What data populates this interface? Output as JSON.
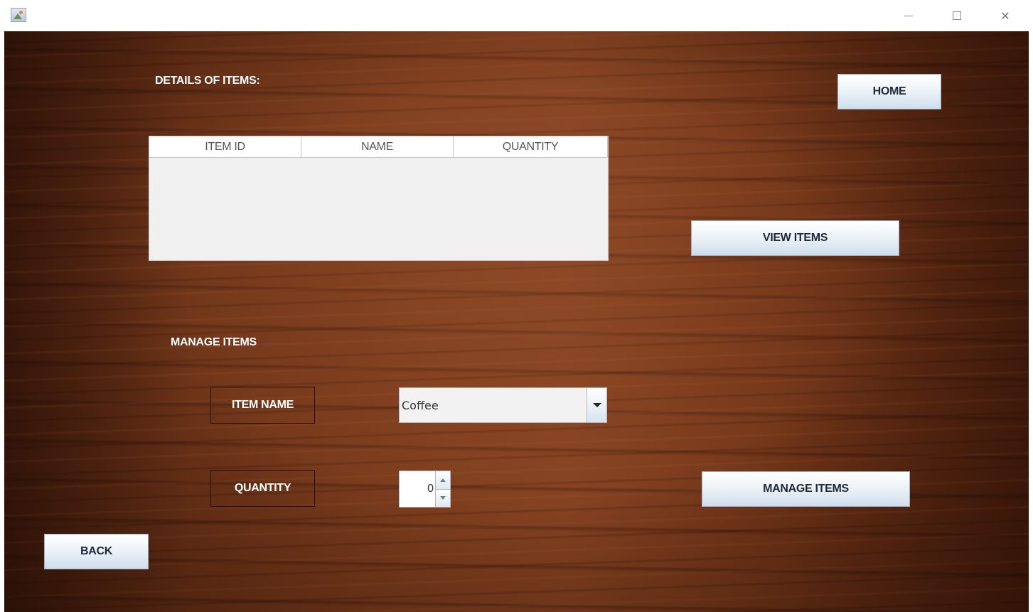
{
  "window": {
    "min_icon": "minimize-icon",
    "max_icon": "maximize-icon",
    "close_icon": "close-icon",
    "close_glyph": "✕"
  },
  "details": {
    "heading": "DETAILS OF ITEMS:",
    "table": {
      "columns": [
        "ITEM ID",
        "NAME",
        "QUANTITY"
      ],
      "rows": []
    }
  },
  "buttons": {
    "home": "HOME",
    "view_items": "VIEW ITEMS",
    "manage_items": "MANAGE ITEMS",
    "back": "BACK"
  },
  "manage": {
    "heading": "MANAGE ITEMS",
    "item_name_label": "ITEM NAME",
    "item_name_value": "Coffee",
    "quantity_label": "QUANTITY",
    "quantity_value": "0"
  },
  "colors": {
    "wood_dark": "#4a1f0d",
    "wood_mid": "#7d3d1d",
    "button_gradient_bottom": "#cfdeed",
    "table_bg": "#f0f0f0"
  }
}
